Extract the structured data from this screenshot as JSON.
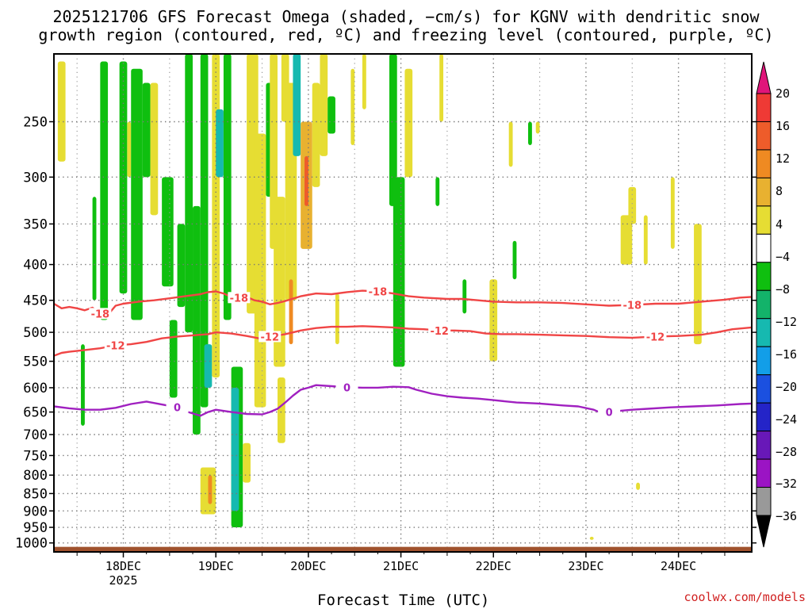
{
  "title": {
    "line1": "2025121706 GFS Forecast Omega (shaded, −cm/s) for KGNV with dendritic snow",
    "line2": "growth region (contoured, red, ºC) and freezing level (contoured, purple, ºC)"
  },
  "credit": "coolwx.com/models",
  "chart_data": {
    "type": "heatmap",
    "title": "2025121706 GFS Forecast Omega (shaded, −cm/s) for KGNV with dendritic snow growth region (contoured, red, ºC) and freezing level (contoured, purple, ºC)",
    "xlabel": "Forecast Time (UTC)",
    "ylabel": "",
    "x_ticks": [
      {
        "label": "18DEC",
        "sub": "2025",
        "t": 24
      },
      {
        "label": "19DEC",
        "sub": "",
        "t": 48
      },
      {
        "label": "20DEC",
        "sub": "",
        "t": 72
      },
      {
        "label": "21DEC",
        "sub": "",
        "t": 96
      },
      {
        "label": "22DEC",
        "sub": "",
        "t": 120
      },
      {
        "label": "23DEC",
        "sub": "",
        "t": 144
      },
      {
        "label": "24DEC",
        "sub": "",
        "t": 168
      }
    ],
    "xlim_hours_from_17DEC_00Z": [
      6,
      187
    ],
    "y_ticks": [
      250,
      300,
      350,
      400,
      450,
      500,
      550,
      600,
      650,
      700,
      750,
      800,
      850,
      900,
      950,
      1000
    ],
    "ylim_hPa": [
      200,
      1030
    ],
    "y_scale": "log-pressure",
    "grid": "dotted",
    "colorbar": {
      "labels": [
        "20",
        "16",
        "12",
        "8",
        "4",
        "−4",
        "−8",
        "−12",
        "−16",
        "−20",
        "−24",
        "−28",
        "−32",
        "−36"
      ],
      "colors": [
        "#e0157a",
        "#ef3a35",
        "#ee5c2a",
        "#ef8a22",
        "#e8b130",
        "#e6dd33",
        "#ffffff",
        "#0fbf0f",
        "#13b36a",
        "#16b9b0",
        "#129ee8",
        "#1b50e0",
        "#2424c8",
        "#6818b8",
        "#9b14c4",
        "#999999",
        "#000000"
      ]
    },
    "contours": [
      {
        "name": "-18",
        "color": "#f04545",
        "labels": [
          "-18",
          "-18",
          "-18",
          "-18"
        ],
        "points": [
          [
            6,
            455
          ],
          [
            8,
            462
          ],
          [
            10,
            460
          ],
          [
            12,
            462
          ],
          [
            14,
            465
          ],
          [
            16,
            461
          ],
          [
            18,
            470
          ],
          [
            20,
            472
          ],
          [
            22,
            458
          ],
          [
            24,
            455
          ],
          [
            28,
            452
          ],
          [
            32,
            450
          ],
          [
            36,
            447
          ],
          [
            40,
            444
          ],
          [
            44,
            441
          ],
          [
            46,
            438
          ],
          [
            48,
            437
          ],
          [
            50,
            440
          ],
          [
            52,
            445
          ],
          [
            54,
            446
          ],
          [
            56,
            445
          ],
          [
            58,
            450
          ],
          [
            60,
            452
          ],
          [
            62,
            456
          ],
          [
            64,
            454
          ],
          [
            66,
            451
          ],
          [
            70,
            444
          ],
          [
            74,
            440
          ],
          [
            78,
            441
          ],
          [
            82,
            438
          ],
          [
            86,
            436
          ],
          [
            90,
            437
          ],
          [
            94,
            440
          ],
          [
            98,
            444
          ],
          [
            102,
            446
          ],
          [
            108,
            448
          ],
          [
            112,
            448
          ],
          [
            116,
            450
          ],
          [
            120,
            452
          ],
          [
            126,
            453
          ],
          [
            132,
            453
          ],
          [
            138,
            454
          ],
          [
            144,
            456
          ],
          [
            150,
            458
          ],
          [
            156,
            457
          ],
          [
            162,
            455
          ],
          [
            168,
            455
          ],
          [
            174,
            452
          ],
          [
            180,
            449
          ],
          [
            184,
            446
          ],
          [
            187,
            445
          ]
        ]
      },
      {
        "name": "-12",
        "color": "#f04545",
        "labels": [
          "-12",
          "-12",
          "-12",
          "-12"
        ],
        "points": [
          [
            6,
            540
          ],
          [
            8,
            535
          ],
          [
            10,
            533
          ],
          [
            14,
            530
          ],
          [
            18,
            527
          ],
          [
            22,
            522
          ],
          [
            26,
            520
          ],
          [
            30,
            516
          ],
          [
            34,
            510
          ],
          [
            38,
            507
          ],
          [
            42,
            505
          ],
          [
            46,
            503
          ],
          [
            48,
            500
          ],
          [
            52,
            502
          ],
          [
            56,
            506
          ],
          [
            60,
            511
          ],
          [
            62,
            507
          ],
          [
            66,
            503
          ],
          [
            70,
            497
          ],
          [
            74,
            493
          ],
          [
            78,
            491
          ],
          [
            82,
            491
          ],
          [
            86,
            490
          ],
          [
            90,
            491
          ],
          [
            94,
            492
          ],
          [
            98,
            494
          ],
          [
            102,
            495
          ],
          [
            106,
            497
          ],
          [
            110,
            497
          ],
          [
            114,
            498
          ],
          [
            118,
            502
          ],
          [
            122,
            503
          ],
          [
            126,
            503
          ],
          [
            132,
            504
          ],
          [
            138,
            505
          ],
          [
            144,
            506
          ],
          [
            150,
            508
          ],
          [
            156,
            509
          ],
          [
            162,
            507
          ],
          [
            168,
            506
          ],
          [
            174,
            504
          ],
          [
            178,
            500
          ],
          [
            182,
            495
          ],
          [
            187,
            492
          ]
        ]
      },
      {
        "name": "0",
        "color": "#a020c0",
        "labels": [
          "0",
          "0",
          "0"
        ],
        "points": [
          [
            6,
            638
          ],
          [
            10,
            642
          ],
          [
            14,
            645
          ],
          [
            18,
            645
          ],
          [
            22,
            641
          ],
          [
            26,
            633
          ],
          [
            30,
            628
          ],
          [
            34,
            634
          ],
          [
            38,
            640
          ],
          [
            40,
            648
          ],
          [
            42,
            653
          ],
          [
            44,
            658
          ],
          [
            46,
            650
          ],
          [
            48,
            645
          ],
          [
            52,
            650
          ],
          [
            56,
            654
          ],
          [
            60,
            655
          ],
          [
            62,
            650
          ],
          [
            64,
            643
          ],
          [
            66,
            630
          ],
          [
            68,
            616
          ],
          [
            70,
            604
          ],
          [
            72,
            600
          ],
          [
            74,
            595
          ],
          [
            78,
            597
          ],
          [
            82,
            599
          ],
          [
            86,
            600
          ],
          [
            90,
            600
          ],
          [
            94,
            598
          ],
          [
            98,
            599
          ],
          [
            100,
            604
          ],
          [
            104,
            612
          ],
          [
            108,
            617
          ],
          [
            112,
            620
          ],
          [
            116,
            622
          ],
          [
            120,
            625
          ],
          [
            126,
            630
          ],
          [
            132,
            632
          ],
          [
            138,
            636
          ],
          [
            142,
            638
          ],
          [
            146,
            645
          ],
          [
            148,
            652
          ],
          [
            150,
            650
          ],
          [
            152,
            648
          ],
          [
            156,
            645
          ],
          [
            160,
            643
          ],
          [
            166,
            640
          ],
          [
            172,
            638
          ],
          [
            178,
            636
          ],
          [
            184,
            633
          ],
          [
            187,
            632
          ]
        ]
      }
    ],
    "shaded_regions": [
      {
        "t0": 7,
        "t1": 9,
        "p0": 205,
        "p1": 285,
        "v": 5
      },
      {
        "t0": 13,
        "t1": 14,
        "p0": 520,
        "p1": 680,
        "v": -6
      },
      {
        "t0": 16,
        "t1": 17,
        "p0": 320,
        "p1": 450,
        "v": -6
      },
      {
        "t0": 18,
        "t1": 20,
        "p0": 205,
        "p1": 480,
        "v": -6
      },
      {
        "t0": 23,
        "t1": 25,
        "p0": 205,
        "p1": 440,
        "v": -6
      },
      {
        "t0": 25,
        "t1": 26,
        "p0": 250,
        "p1": 300,
        "v": 5
      },
      {
        "t0": 26,
        "t1": 29,
        "p0": 210,
        "p1": 480,
        "v": -6
      },
      {
        "t0": 29,
        "t1": 31,
        "p0": 220,
        "p1": 300,
        "v": -6
      },
      {
        "t0": 31,
        "t1": 33,
        "p0": 220,
        "p1": 340,
        "v": 5
      },
      {
        "t0": 34,
        "t1": 37,
        "p0": 300,
        "p1": 430,
        "v": -6
      },
      {
        "t0": 36,
        "t1": 38,
        "p0": 480,
        "p1": 620,
        "v": -6
      },
      {
        "t0": 38,
        "t1": 40,
        "p0": 350,
        "p1": 460,
        "v": -6
      },
      {
        "t0": 40,
        "t1": 42,
        "p0": 200,
        "p1": 500,
        "v": -6
      },
      {
        "t0": 42,
        "t1": 44,
        "p0": 330,
        "p1": 700,
        "v": -6
      },
      {
        "t0": 44,
        "t1": 46,
        "p0": 200,
        "p1": 640,
        "v": -6
      },
      {
        "t0": 45,
        "t1": 47,
        "p0": 520,
        "p1": 600,
        "v": -12
      },
      {
        "t0": 44,
        "t1": 48,
        "p0": 780,
        "p1": 910,
        "v": 5
      },
      {
        "t0": 46,
        "t1": 47,
        "p0": 800,
        "p1": 880,
        "v": 12
      },
      {
        "t0": 47,
        "t1": 49,
        "p0": 200,
        "p1": 580,
        "v": 5
      },
      {
        "t0": 48,
        "t1": 50,
        "p0": 240,
        "p1": 300,
        "v": -12
      },
      {
        "t0": 50,
        "t1": 52,
        "p0": 200,
        "p1": 480,
        "v": -6
      },
      {
        "t0": 52,
        "t1": 55,
        "p0": 560,
        "p1": 950,
        "v": -6
      },
      {
        "t0": 52,
        "t1": 54,
        "p0": 600,
        "p1": 900,
        "v": -12
      },
      {
        "t0": 55,
        "t1": 57,
        "p0": 720,
        "p1": 820,
        "v": 5
      },
      {
        "t0": 56,
        "t1": 59,
        "p0": 200,
        "p1": 470,
        "v": 5
      },
      {
        "t0": 58,
        "t1": 61,
        "p0": 260,
        "p1": 640,
        "v": 5
      },
      {
        "t0": 61,
        "t1": 63,
        "p0": 220,
        "p1": 320,
        "v": -6
      },
      {
        "t0": 62,
        "t1": 64,
        "p0": 200,
        "p1": 380,
        "v": 5
      },
      {
        "t0": 63,
        "t1": 66,
        "p0": 320,
        "p1": 560,
        "v": 5
      },
      {
        "t0": 64,
        "t1": 66,
        "p0": 580,
        "p1": 720,
        "v": 5
      },
      {
        "t0": 65,
        "t1": 67,
        "p0": 200,
        "p1": 250,
        "v": 5
      },
      {
        "t0": 66,
        "t1": 69,
        "p0": 220,
        "p1": 450,
        "v": 5
      },
      {
        "t0": 67,
        "t1": 68,
        "p0": 420,
        "p1": 520,
        "v": 12
      },
      {
        "t0": 68,
        "t1": 70,
        "p0": 200,
        "p1": 280,
        "v": -12
      },
      {
        "t0": 70,
        "t1": 73,
        "p0": 250,
        "p1": 380,
        "v": 8
      },
      {
        "t0": 71,
        "t1": 72,
        "p0": 280,
        "p1": 330,
        "v": 16
      },
      {
        "t0": 73,
        "t1": 75,
        "p0": 220,
        "p1": 310,
        "v": 5
      },
      {
        "t0": 75,
        "t1": 77,
        "p0": 200,
        "p1": 280,
        "v": 5
      },
      {
        "t0": 77,
        "t1": 79,
        "p0": 230,
        "p1": 260,
        "v": -6
      },
      {
        "t0": 79,
        "t1": 80,
        "p0": 440,
        "p1": 520,
        "v": 5
      },
      {
        "t0": 83,
        "t1": 84,
        "p0": 210,
        "p1": 270,
        "v": 5
      },
      {
        "t0": 86,
        "t1": 87,
        "p0": 200,
        "p1": 240,
        "v": 5
      },
      {
        "t0": 93,
        "t1": 95,
        "p0": 200,
        "p1": 330,
        "v": -6
      },
      {
        "t0": 94,
        "t1": 97,
        "p0": 300,
        "p1": 560,
        "v": -6
      },
      {
        "t0": 97,
        "t1": 99,
        "p0": 210,
        "p1": 300,
        "v": 5
      },
      {
        "t0": 105,
        "t1": 106,
        "p0": 300,
        "p1": 330,
        "v": -6
      },
      {
        "t0": 106,
        "t1": 107,
        "p0": 200,
        "p1": 250,
        "v": 5
      },
      {
        "t0": 112,
        "t1": 113,
        "p0": 420,
        "p1": 470,
        "v": -6
      },
      {
        "t0": 119,
        "t1": 121,
        "p0": 420,
        "p1": 550,
        "v": 5
      },
      {
        "t0": 124,
        "t1": 125,
        "p0": 250,
        "p1": 290,
        "v": 5
      },
      {
        "t0": 125,
        "t1": 126,
        "p0": 370,
        "p1": 420,
        "v": -6
      },
      {
        "t0": 129,
        "t1": 130,
        "p0": 250,
        "p1": 270,
        "v": -6
      },
      {
        "t0": 131,
        "t1": 132,
        "p0": 250,
        "p1": 260,
        "v": 5
      },
      {
        "t0": 145,
        "t1": 146,
        "p0": 980,
        "p1": 990,
        "v": 5
      },
      {
        "t0": 153,
        "t1": 156,
        "p0": 340,
        "p1": 400,
        "v": 5
      },
      {
        "t0": 155,
        "t1": 157,
        "p0": 310,
        "p1": 350,
        "v": 5
      },
      {
        "t0": 157,
        "t1": 158,
        "p0": 820,
        "p1": 840,
        "v": 5
      },
      {
        "t0": 159,
        "t1": 160,
        "p0": 340,
        "p1": 400,
        "v": 5
      },
      {
        "t0": 166,
        "t1": 167,
        "p0": 300,
        "p1": 380,
        "v": 5
      },
      {
        "t0": 172,
        "t1": 174,
        "p0": 350,
        "p1": 520,
        "v": 5
      }
    ]
  }
}
